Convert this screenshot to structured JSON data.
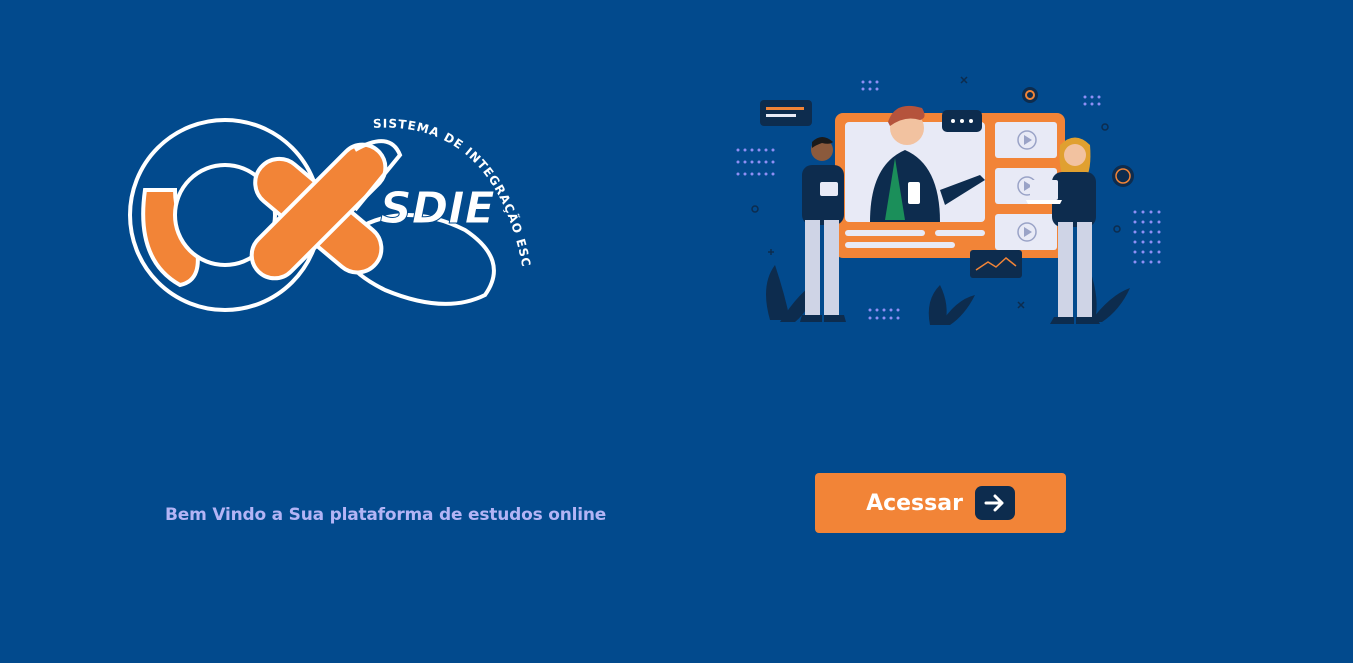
{
  "logo": {
    "wordmark": "SDIE",
    "tagline": "SISTEMA DE INTEGRAÇÃO ESCOLAR"
  },
  "illustration": {
    "icon": "online-class-illustration"
  },
  "welcome": {
    "text": "Bem Vindo a Sua plataforma de estudos online"
  },
  "access_button": {
    "label": "Acessar",
    "icon": "arrow-right-icon"
  },
  "colors": {
    "background": "#024a8d",
    "accent": "#f28437",
    "welcome_text": "#b3b4f5",
    "icon_box": "#0d2c4e"
  }
}
